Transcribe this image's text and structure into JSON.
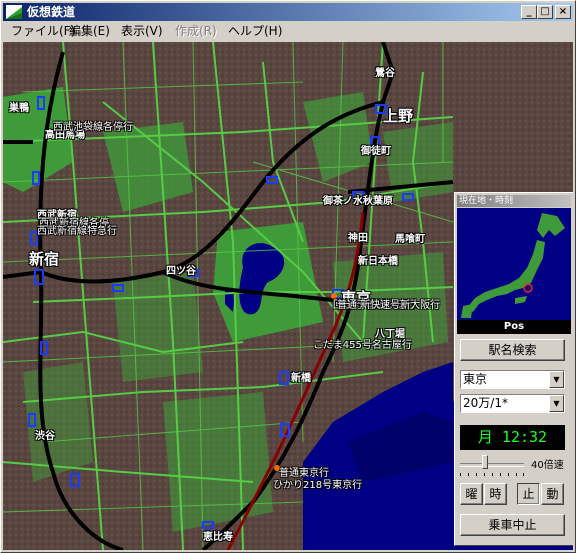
{
  "window": {
    "title": "仮想鉄道"
  },
  "menu": [
    {
      "label": "ファイル(F)",
      "enabled": true
    },
    {
      "label": "編集(E)",
      "enabled": true
    },
    {
      "label": "表示(V)",
      "enabled": true
    },
    {
      "label": "作成(R)",
      "enabled": false
    },
    {
      "label": "ヘルプ(H)",
      "enabled": true
    }
  ],
  "map": {
    "stations": [
      {
        "id": "sugamo",
        "label": "巣鴨"
      },
      {
        "id": "uguisudani",
        "label": "鶯谷"
      },
      {
        "id": "ueno",
        "label": "上野"
      },
      {
        "id": "okachimachi",
        "label": "御徒町"
      },
      {
        "id": "ochanomizu",
        "label": "御茶ノ水"
      },
      {
        "id": "akihabara",
        "label": "秋葉原"
      },
      {
        "id": "kanda",
        "label": "神田"
      },
      {
        "id": "bakurocho",
        "label": "馬喰町"
      },
      {
        "id": "shin_nihombashi",
        "label": "新日本橋"
      },
      {
        "id": "yotsuya",
        "label": "四ツ谷"
      },
      {
        "id": "takadanobaba",
        "label": "高田馬場"
      },
      {
        "id": "seibu_shinjuku",
        "label": "西武新宿"
      },
      {
        "id": "shinjuku",
        "label": "新宿"
      },
      {
        "id": "tokyo",
        "label": "東京"
      },
      {
        "id": "hatchobori",
        "label": "八丁堀"
      },
      {
        "id": "shimbashi",
        "label": "新橋"
      },
      {
        "id": "shibuya",
        "label": "渋谷"
      },
      {
        "id": "ebisu",
        "label": "恵比寿"
      }
    ],
    "trains": [
      {
        "id": "t1",
        "label": "西武池袋線各停行"
      },
      {
        "id": "t2",
        "label": "西武新宿線各停"
      },
      {
        "id": "t3",
        "label": "西武新宿線特急行"
      },
      {
        "id": "t4",
        "label": "回送行 普通快速行"
      },
      {
        "id": "t5",
        "label": "普通 新快速号新大阪行"
      },
      {
        "id": "t6",
        "label": "こだま455号名古屋行"
      },
      {
        "id": "t7",
        "label": "普通東京行"
      },
      {
        "id": "t8",
        "label": "ひかり218号東京行"
      }
    ],
    "colors": {
      "land": "#5e4a45",
      "water": "#000084",
      "park": "#3f9a3a",
      "road": "#55cc44",
      "rail": "#000000",
      "station": "#1a3cff"
    }
  },
  "panel": {
    "title": "現在地・時刻",
    "pos_label": "Pos",
    "station_search_label": "駅名検索",
    "location_select": "東京",
    "scale_select": "20万/1*",
    "clock": "月 12:32",
    "speed_label": "40倍速",
    "speed_level": 0.4,
    "buttons": {
      "weekday": "曜",
      "hour": "時",
      "stop": "止",
      "move": "動"
    },
    "quit_label": "乗車中止"
  }
}
